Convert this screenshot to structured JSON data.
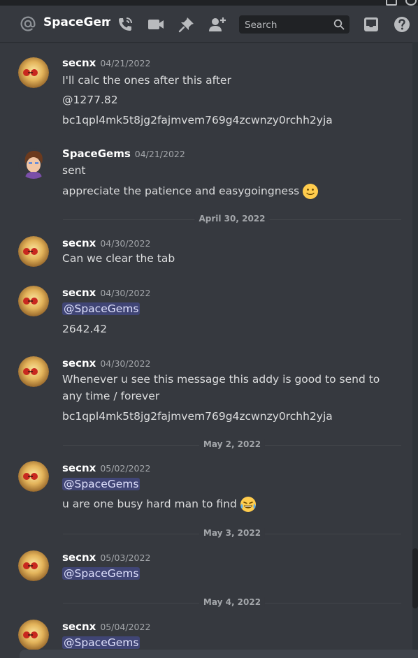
{
  "header": {
    "channel_name": "SpaceGems",
    "search_placeholder": "Search"
  },
  "dividers": [
    "April 30, 2022",
    "May 2, 2022",
    "May 3, 2022",
    "May 4, 2022"
  ],
  "messages": [
    {
      "author": "secnx",
      "timestamp": "04/21/2022",
      "lines": [
        "I'll calc the ones after this after",
        "@1277.82",
        "bc1qpl4mk5t8jg2fajmvem769g4zcwnzy0rchh2yja"
      ]
    },
    {
      "author": "SpaceGems",
      "timestamp": "04/21/2022",
      "lines": [
        "sent",
        "appreciate the patience and easygoingness"
      ]
    },
    {
      "author": "secnx",
      "timestamp": "04/30/2022",
      "lines": [
        "Can we clear the tab"
      ]
    },
    {
      "author": "secnx",
      "timestamp": "04/30/2022",
      "mention": "@SpaceGems",
      "lines": [
        "2642.42"
      ]
    },
    {
      "author": "secnx",
      "timestamp": "04/30/2022",
      "lines": [
        "Whenever u see this message this addy is good to send to",
        "any time / forever",
        "bc1qpl4mk5t8jg2fajmvem769g4zcwnzy0rchh2yja"
      ]
    },
    {
      "author": "secnx",
      "timestamp": "05/02/2022",
      "mention": "@SpaceGems",
      "lines": [
        "u are one busy hard man to find"
      ]
    },
    {
      "author": "secnx",
      "timestamp": "05/03/2022",
      "mention": "@SpaceGems",
      "lines": []
    },
    {
      "author": "secnx",
      "timestamp": "05/04/2022",
      "mention": "@SpaceGems",
      "lines": []
    }
  ],
  "icons": {
    "at": "at-sign-icon",
    "threads": "phone-call-icon",
    "video": "video-camera-icon",
    "pin": "pin-icon",
    "add_member": "add-friend-icon",
    "search": "search-icon",
    "inbox": "inbox-icon",
    "help": "help-icon",
    "emoji_smile": "slightly-smiling-face-emoji",
    "emoji_laugh": "tears-of-joy-emoji"
  },
  "colors": {
    "background": "#36393f",
    "mention_bg": "#3c4270",
    "mention_text": "#dee0fc",
    "timestamp": "#a3a6aa"
  }
}
